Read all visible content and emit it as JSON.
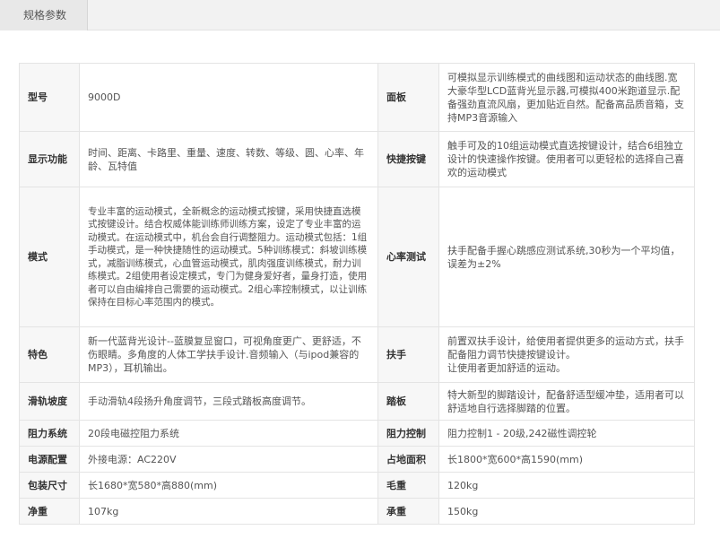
{
  "tab": {
    "label": "规格参数"
  },
  "rows": [
    {
      "k1": "型号",
      "v1": "9000D",
      "k2": "面板",
      "v2": "可模拟显示训练模式的曲线图和运动状态的曲线图.宽大豪华型LCD蓝背光显示器,可模拟400米跑道显示.配备强劲直流风扇，更加贴近自然。配备高品质音箱，支持MP3音源输入"
    },
    {
      "k1": "显示功能",
      "v1": "时间、距离、卡路里、重量、速度、转数、等级、圆、心率、年龄、瓦特值",
      "k2": "快捷按键",
      "v2": "触手可及的10组运动模式直选按键设计，结合6组独立设计的快速操作按键。使用者可以更轻松的选择自己喜欢的运动模式"
    },
    {
      "k1": "模式",
      "v1": "专业丰富的运动模式，全新概念的运动模式按键，采用快捷直选模式按键设计。结合权威体能训练师训练方案，设定了专业丰富的运动模式。在运动模式中，机台会自行调整阻力。运动模式包括：1组手动模式，是一种快捷随性的运动模式。5种训练模式：斜坡训练模式，减脂训练模式，心血管运动模式，肌肉强度训练模式，耐力训练模式。2组使用者设定模式，专门为健身爱好者，量身打造，使用者可以自由编排自己需要的运动模式。2组心率控制模式，以让训练保持在目标心率范围内的模式。",
      "k2": "心率测试",
      "v2": "扶手配备手握心跳感应测试系统,30秒为一个平均值，误差为±2%"
    },
    {
      "k1": "特色",
      "v1": "新一代蓝背光设计--蓝膜复显窗口，可视角度更广、更舒适，不伤眼睛。多角度的人体工学扶手设计.音频输入（与ipod兼容的MP3），耳机输出。",
      "k2": "扶手",
      "v2": "前置双扶手设计，给使用者提供更多的运动方式，扶手配备阻力调节快捷按键设计。\n让使用者更加舒适的运动。"
    },
    {
      "k1": "滑轨坡度",
      "v1": "手动滑轨4段扬升角度调节，三段式踏板高度调节。",
      "k2": "踏板",
      "v2": "特大新型的脚踏设计，配备舒适型缓冲垫，适用者可以舒适地自行选择脚踏的位置。"
    },
    {
      "k1": "阻力系统",
      "v1": "20段电磁控阻力系统",
      "k2": "阻力控制",
      "v2": "阻力控制1 - 20级,242磁性调控轮"
    },
    {
      "k1": "电源配置",
      "v1": "外接电源：AC220V",
      "k2": "占地面积",
      "v2": "长1800*宽600*高1590(mm)"
    },
    {
      "k1": "包装尺寸",
      "v1": "长1680*宽580*高880(mm)",
      "k2": "毛重",
      "v2": "120kg"
    },
    {
      "k1": "净重",
      "v1": "107kg",
      "k2": "承重",
      "v2": "150kg"
    }
  ]
}
